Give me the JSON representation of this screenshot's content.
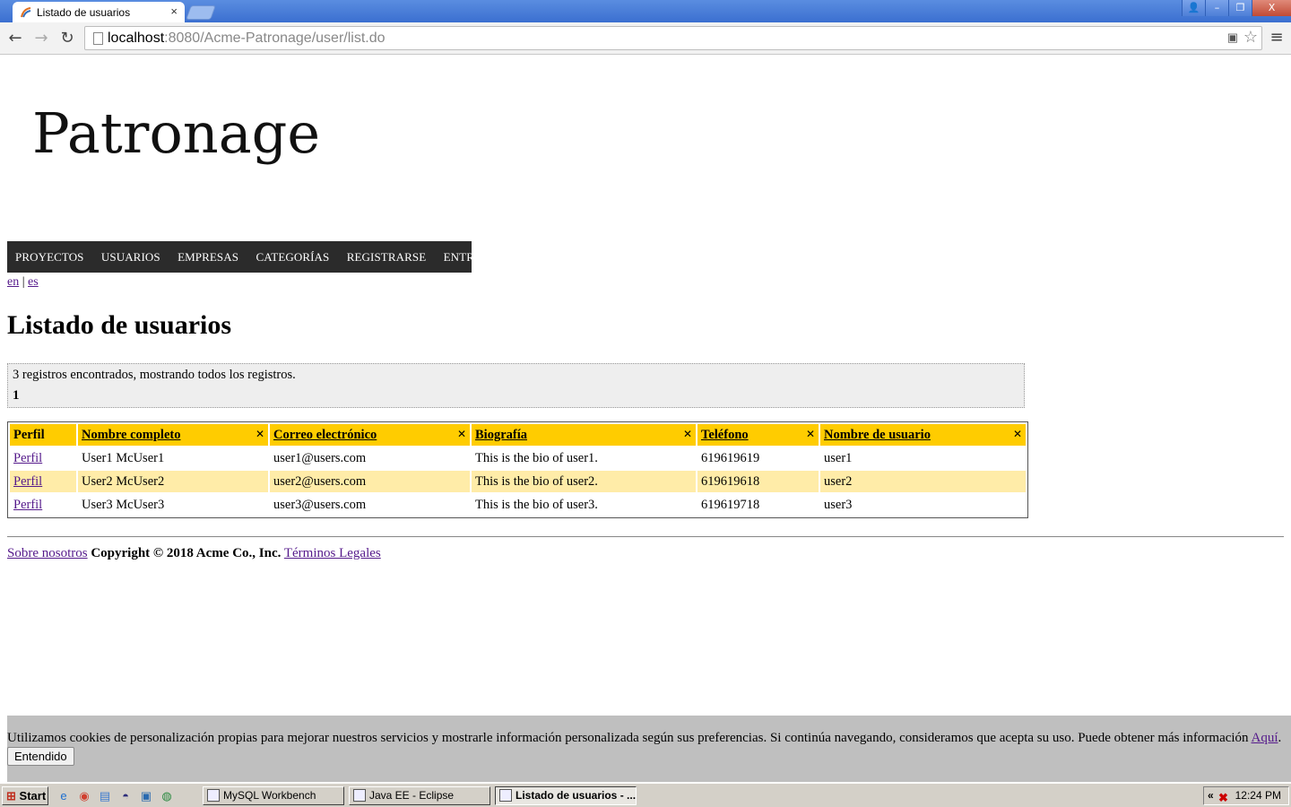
{
  "browser": {
    "tab_title": "Listado de usuarios",
    "tab_close": "×",
    "url_host": "localhost",
    "url_rest": ":8080/Acme-Patronage/user/list.do",
    "window_controls": [
      "👤",
      "–",
      "❐",
      "X"
    ]
  },
  "logo": "Patronage",
  "nav": [
    "PROYECTOS",
    "USUARIOS",
    "EMPRESAS",
    "CATEGORÍAS",
    "REGISTRARSE",
    "ENTRAR"
  ],
  "lang": {
    "en": "en",
    "sep": "|",
    "es": "es"
  },
  "title": "Listado de usuarios",
  "banner": {
    "found": "3 registros encontrados, mostrando todos los registros.",
    "page": "1"
  },
  "table": {
    "headers": [
      "Perfil",
      "Nombre completo",
      "Correo electrónico",
      "Biografía",
      "Teléfono",
      "Nombre de usuario"
    ],
    "rows": [
      [
        "Perfil",
        "User1 McUser1",
        "user1@users.com",
        "This is the bio of user1.",
        "619619619",
        "user1"
      ],
      [
        "Perfil",
        "User2 McUser2",
        "user2@users.com",
        "This is the bio of user2.",
        "619619618",
        "user2"
      ],
      [
        "Perfil",
        "User3 McUser3",
        "user3@users.com",
        "This is the bio of user3.",
        "619619718",
        "user3"
      ]
    ]
  },
  "footer": {
    "about": "Sobre nosotros",
    "copyright": "Copyright © 2018 Acme Co., Inc.",
    "legal": "Términos Legales"
  },
  "cookie": {
    "message": "Utilizamos cookies de personalización propias para mejorar nuestros servicios y mostrarle información personalizada según sus preferencias. Si continúa navegando, consideramos que acepta su uso. Puede obtener más información",
    "link": "Aquí",
    "button": "Entendido"
  },
  "taskbar": {
    "start": "Start",
    "tasks": [
      "MySQL Workbench",
      "Java EE - Eclipse",
      "Listado de usuarios - ..."
    ],
    "tray_chevron": "«",
    "time": "12:24 PM"
  },
  "colors": {
    "header_bg": "#ffcc00",
    "row_alt": "#ffeca8",
    "nav_bg": "#2b2b2b",
    "cookie_bg": "#bfbfbf"
  }
}
